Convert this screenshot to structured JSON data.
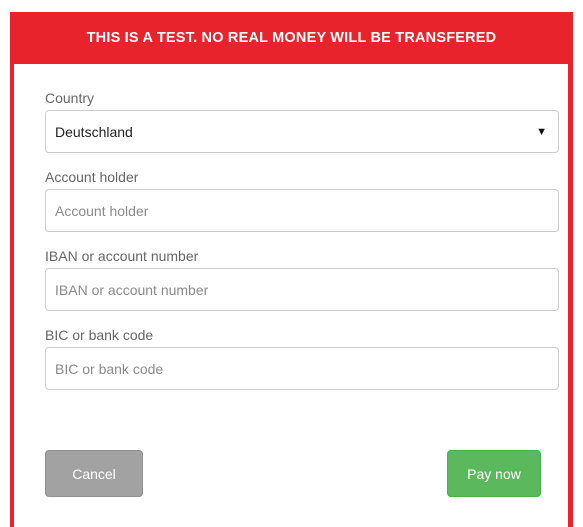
{
  "banner": {
    "text": "THIS IS A TEST. NO REAL MONEY WILL BE TRANSFERED"
  },
  "form": {
    "country": {
      "label": "Country",
      "selected": "Deutschland"
    },
    "account_holder": {
      "label": "Account holder",
      "placeholder": "Account holder",
      "value": ""
    },
    "iban": {
      "label": "IBAN or account number",
      "placeholder": "IBAN or account number",
      "value": ""
    },
    "bic": {
      "label": "BIC or bank code",
      "placeholder": "BIC or bank code",
      "value": ""
    }
  },
  "actions": {
    "cancel_label": "Cancel",
    "pay_label": "Pay now"
  },
  "colors": {
    "banner": "#e8232b",
    "pay_button": "#5cb85c",
    "cancel_button": "#a2a2a2"
  },
  "icons": {
    "select_caret": "▼"
  }
}
